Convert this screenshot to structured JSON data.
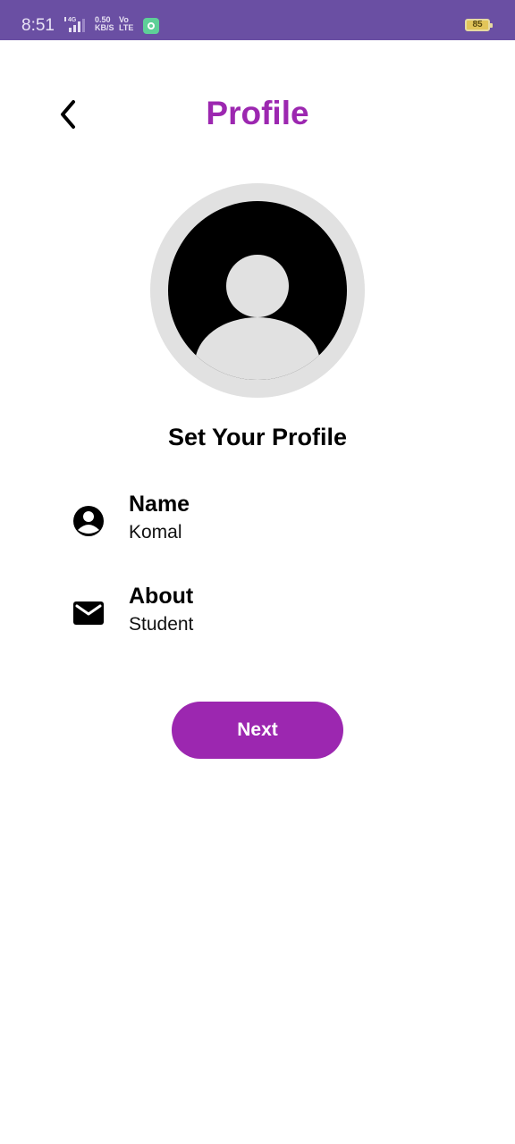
{
  "status_bar": {
    "time": "8:51",
    "network": "4G",
    "speed_value": "0.50",
    "speed_unit": "KB/S",
    "volte_top": "Vo",
    "volte_bottom": "LTE",
    "battery": "85",
    "color": "#6a4fa3"
  },
  "header": {
    "title": "Profile",
    "back_icon": "chevron-left-icon"
  },
  "avatar": {
    "icon": "account-circle-icon"
  },
  "heading": "Set Your Profile",
  "fields": [
    {
      "icon": "account-circle-icon",
      "label": "Name",
      "value": "Komal"
    },
    {
      "icon": "envelope-icon",
      "label": "About",
      "value": "Student"
    }
  ],
  "next_button": {
    "label": "Next"
  },
  "colors": {
    "accent": "#9c27b0",
    "avatar_ring": "#e1e1e1"
  }
}
